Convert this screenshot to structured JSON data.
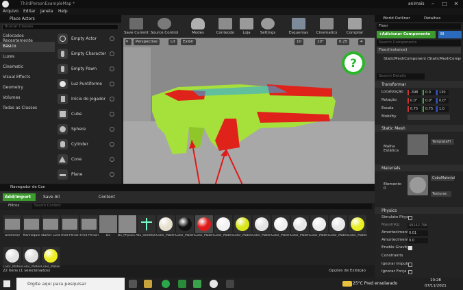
{
  "window": {
    "title": "ThirdPersonExampleMap *",
    "user": "animais",
    "min": "–",
    "max": "□",
    "close": "✕"
  },
  "menu": [
    "Arquivo",
    "Editar",
    "Janela",
    "Help"
  ],
  "place_actors": {
    "tab": "Place Actors",
    "search_placeholder": "Buscar Classes",
    "categories": [
      "Colocados Recentemente",
      "Básico",
      "Luzes",
      "Cinematic",
      "Visual Effects",
      "Geometry",
      "Volumes",
      "Todas as Classes"
    ],
    "items": [
      "Empty Actor",
      "Empty Character",
      "Empty Pawn",
      "Luz Puntiforme",
      "Início do Jogador",
      "Cube",
      "Sphere",
      "Cylinder",
      "Cone",
      "Plane"
    ]
  },
  "toolbar": [
    "Save Current",
    "Source Control",
    "Modes",
    "Conteúdo",
    "Loja",
    "Settings",
    "Esquemas",
    "Cinematics",
    "Compilar"
  ],
  "viewport": {
    "perspective": "Perspective",
    "lit": "Lit",
    "show": "Exibir",
    "grid": "10",
    "rotate": "10°",
    "scale": "0.25",
    "camera": "4"
  },
  "outliner": {
    "tab1": "World Outliner",
    "tab2": "Detalhes",
    "actor_name": "Floor",
    "add_component": "+Adicionar Componente",
    "blueprint": "Bl",
    "search_components": "Search Components",
    "instance": "Floor(Instance)",
    "component": "StaticMeshComponent (StaticMeshComponent)",
    "search_details": "Search Details"
  },
  "details": {
    "transform": "Transformar",
    "location_label": "Localização",
    "location": [
      "-398",
      "0.0",
      "130"
    ],
    "rotation_label": "Rotação",
    "rotation": [
      "0.0°",
      "0.0°",
      "0.0°"
    ],
    "scale_label": "Escala",
    "scale": [
      "0.75",
      "0.75",
      "1.0"
    ],
    "mobility_label": "Mobility",
    "static_mesh": "Static Mesh",
    "mesh_label": "Malha Estática",
    "mesh_value": "TemplateFl",
    "materials": "Materials",
    "element_label": "Elemento 0",
    "material_value": "CubeMaterial",
    "textures": "Texturas",
    "physics": "Physics",
    "simulate": "Simulate Phys",
    "mass_label": "MassInKg",
    "mass_value": "49142.796",
    "linear_damping_label": "Amortecimento",
    "linear_damping": "0.01",
    "angular_damping_label": "Amortecimento",
    "angular_damping": "0.0",
    "gravity": "Enable Gravity",
    "constraints": "Constraints",
    "ignore_impulse": "Ignorar Impuls",
    "ignore_force": "Ignorar Força"
  },
  "content_browser": {
    "tab": "Navegador de Con",
    "add_import": "Add/Import",
    "save_all": "Save All",
    "path": "Content",
    "filters": "Filtros",
    "search_placeholder": "Search Content",
    "assets": [
      {
        "name": "Geometry",
        "kind": "folder"
      },
      {
        "name": "Mannequin",
        "kind": "folder"
      },
      {
        "name": "Starter Content",
        "kind": "folder"
      },
      {
        "name": "Third Person",
        "kind": "folder"
      },
      {
        "name": "Third PersonBP",
        "kind": "folder"
      },
      {
        "name": "B5",
        "kind": "mesh"
      },
      {
        "name": "B5_Physics Asset",
        "kind": "mesh"
      },
      {
        "name": "B5_Skeleton",
        "kind": "skeleton"
      },
      {
        "name": "Color_Material",
        "kind": "material",
        "color": "#e8e0cf"
      },
      {
        "name": "Color_Material_M 0000",
        "kind": "material",
        "color": "#111111"
      },
      {
        "name": "Color_Material_M 0001",
        "kind": "material",
        "color": "#e01a1a"
      },
      {
        "name": "Color_Material_M 0002",
        "kind": "material",
        "color": "#f2f2f2"
      },
      {
        "name": "Color_Material_M 0003",
        "kind": "material",
        "color": "#d9e61a"
      },
      {
        "name": "Color_Material_M 0004",
        "kind": "material",
        "color": "#e4e4e4"
      },
      {
        "name": "Color_Material_M 0005",
        "kind": "material",
        "color": "#f0f0f0"
      },
      {
        "name": "Color_Material_M 0006",
        "kind": "material",
        "color": "#e6e6e6"
      },
      {
        "name": "Color_Material_M 0007",
        "kind": "material",
        "color": "#ededed"
      },
      {
        "name": "Color_Material_M 0008",
        "kind": "material",
        "color": "#e8e8e8"
      },
      {
        "name": "Color_Material_M 0009",
        "kind": "material",
        "color": "#e8ef23"
      },
      {
        "name": "Color_Material_M 0010",
        "kind": "material",
        "color": "#e4e4e4"
      },
      {
        "name": "Color_Material_M 0011",
        "kind": "material",
        "color": "#e0e0e0"
      },
      {
        "name": "Color_Material_M 0012",
        "kind": "material",
        "color": "#eeee22"
      }
    ],
    "status": "22 itens (1 selecionados)",
    "view_options": "Opções de Exibição"
  },
  "taskbar": {
    "search_placeholder": "Digite aqui para pesquisar",
    "weather": "25°C  Pred ensolarado",
    "time": "10:28",
    "date": "07/11/2021"
  },
  "colors": {
    "accent_green": "#3c9a2e",
    "gun_green": "#a6e03a",
    "gun_red": "#e0231a",
    "arrow_red": "#e01818"
  }
}
